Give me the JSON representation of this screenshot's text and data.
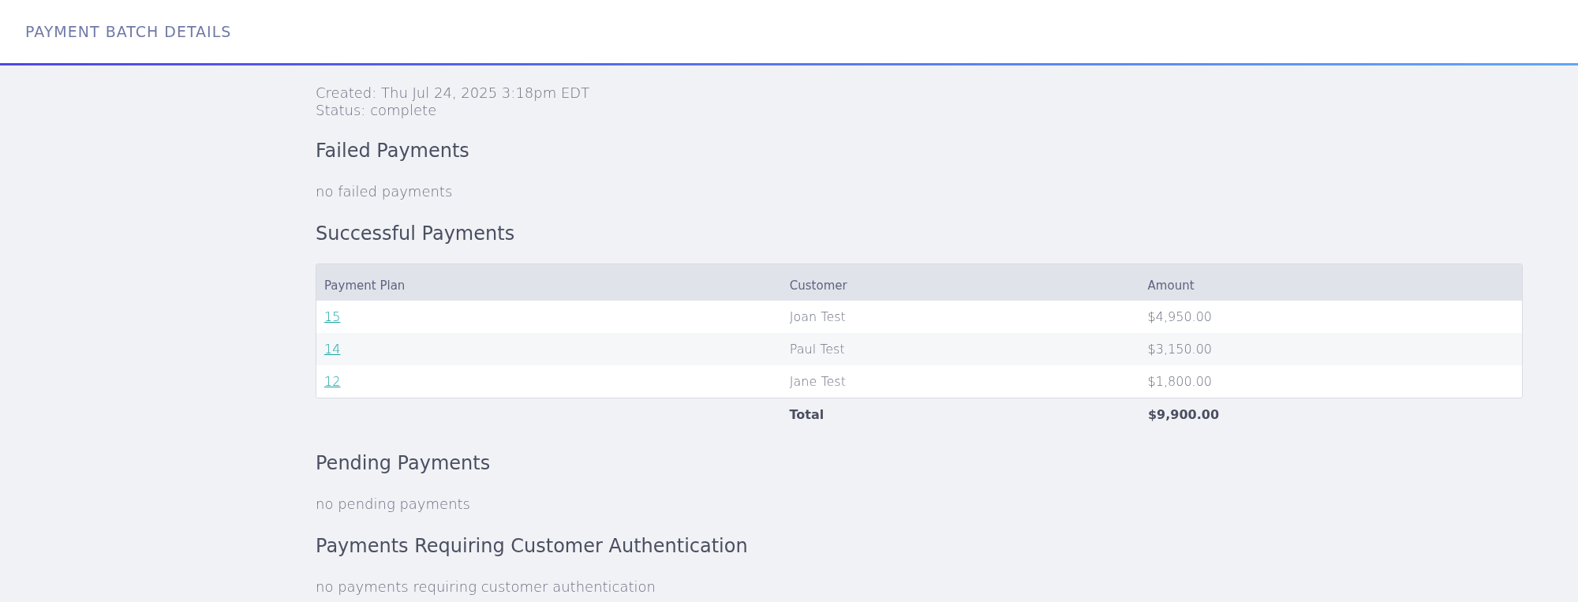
{
  "header": {
    "title": "PAYMENT BATCH DETAILS"
  },
  "meta": [
    "Created: Thu Jul 24, 2025 3:18pm EDT",
    "Status: complete"
  ],
  "sections": [
    {
      "kind": "message",
      "heading": "Failed Payments",
      "message": "no failed payments"
    },
    {
      "kind": "table",
      "heading": "Successful Payments",
      "columns": [
        "Payment Plan",
        "Customer",
        "Amount"
      ],
      "rows": [
        {
          "plan": "15",
          "customer": "Joan Test",
          "amount": "$4,950.00"
        },
        {
          "plan": "14",
          "customer": "Paul Test",
          "amount": "$3,150.00"
        },
        {
          "plan": "12",
          "customer": "Jane Test",
          "amount": "$1,800.00"
        }
      ],
      "total_label": "Total",
      "total": "$9,900.00"
    },
    {
      "kind": "message",
      "heading": "Pending Payments",
      "message": "no pending payments"
    },
    {
      "kind": "message",
      "heading": "Payments Requiring Customer Authentication",
      "message": "no payments requiring customer authentication"
    }
  ]
}
